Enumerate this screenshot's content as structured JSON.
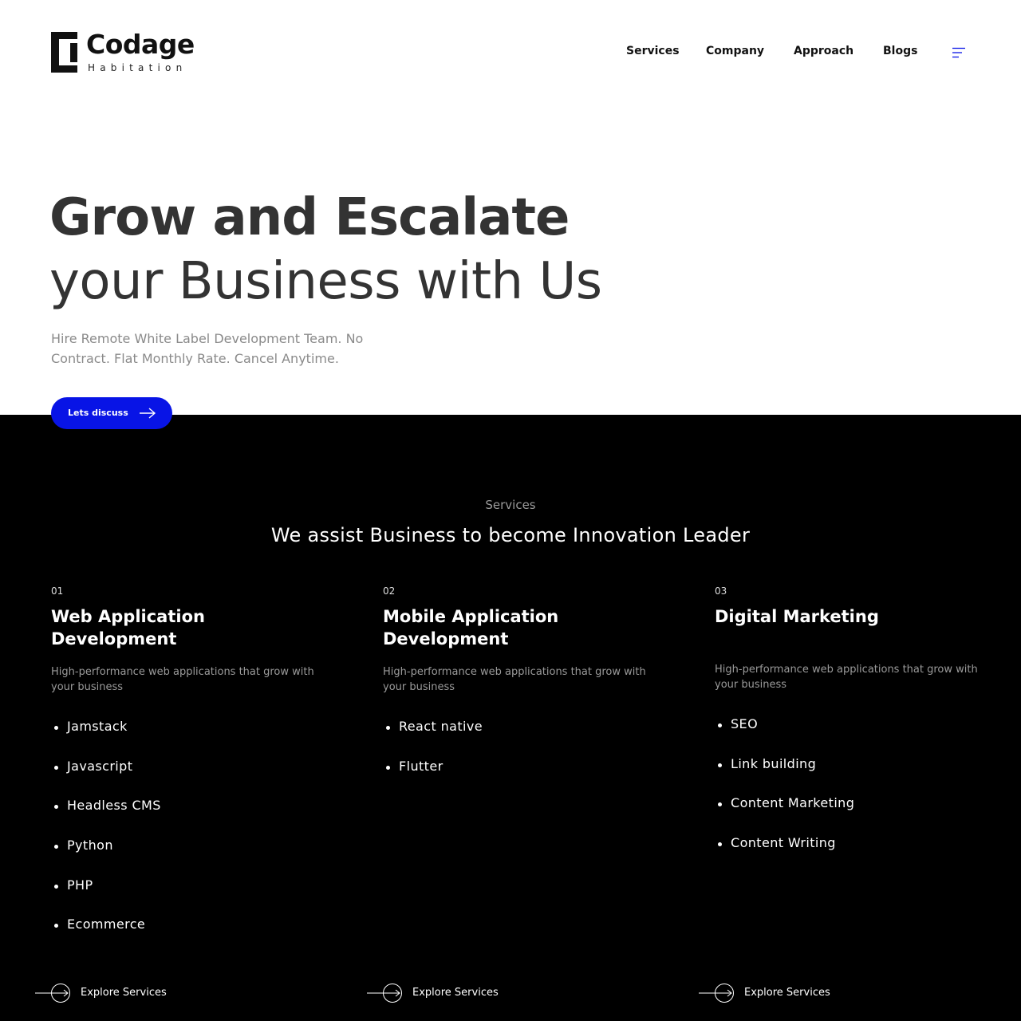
{
  "brand": {
    "name": "Codage",
    "tagline": "Habitation"
  },
  "nav": {
    "items": [
      "Services",
      "Company",
      "Approach",
      "Blogs"
    ],
    "menu_icon": "hamburger-menu-icon",
    "menu_icon_color": "#0814e6"
  },
  "hero": {
    "title_bold": "Grow and Escalate",
    "title_light": "your Business with Us",
    "subtitle": "Hire Remote White Label Development Team. No Contract. Flat Monthly Rate. Cancel Anytime.",
    "cta_label": "Lets discuss",
    "cta_icon": "arrow-right-icon"
  },
  "services": {
    "eyebrow": "Services",
    "heading": "We assist Business to become Innovation Leader",
    "columns": [
      {
        "number": "01",
        "title": "Web Application Development",
        "description": "High-performance web applications that grow with your business",
        "items": [
          "Jamstack",
          "Javascript",
          "Headless CMS",
          "Python",
          "PHP",
          "Ecommerce"
        ],
        "explore_label": "Explore Services"
      },
      {
        "number": "02",
        "title": "Mobile Application Development",
        "description": "High-performance web applications that grow with your business",
        "items": [
          "React native",
          "Flutter"
        ],
        "explore_label": "Explore Services"
      },
      {
        "number": "03",
        "title": "Digital Marketing",
        "description": "High-performance web applications that grow with your business",
        "items": [
          "SEO",
          "Link building",
          "Content Marketing",
          "Content Writing"
        ],
        "explore_label": "Explore Services"
      }
    ]
  },
  "colors": {
    "accent": "#0814e6",
    "dark_section": "#000000",
    "heading_text": "#333333",
    "muted_text": "#8a8a8a"
  }
}
